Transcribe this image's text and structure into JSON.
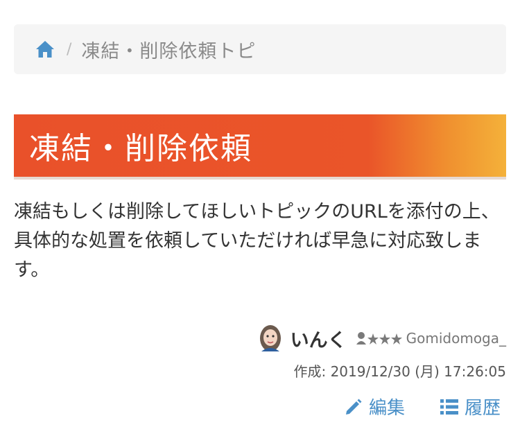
{
  "breadcrumb": {
    "home_icon": "home-icon",
    "separator": "/",
    "current": "凍結・削除依頼トピ"
  },
  "title": "凍結・削除依頼",
  "description": "凍結もしくは削除してほしいトピックのURLを添付の上、具体的な処置を依頼していただければ早急に対応致します。",
  "author": {
    "name": "いんく",
    "rank_icon": "user-rank-icon",
    "user_id": "Gomidomoga_"
  },
  "created": "作成: 2019/12/30 (月) 17:26:05",
  "actions": {
    "edit_label": "編集",
    "history_label": "履歴"
  },
  "colors": {
    "title_bar": "#ea5529",
    "title_bar_end": "#f4b13a",
    "link": "#4a90c8",
    "breadcrumb_bg": "#f5f5f5"
  }
}
